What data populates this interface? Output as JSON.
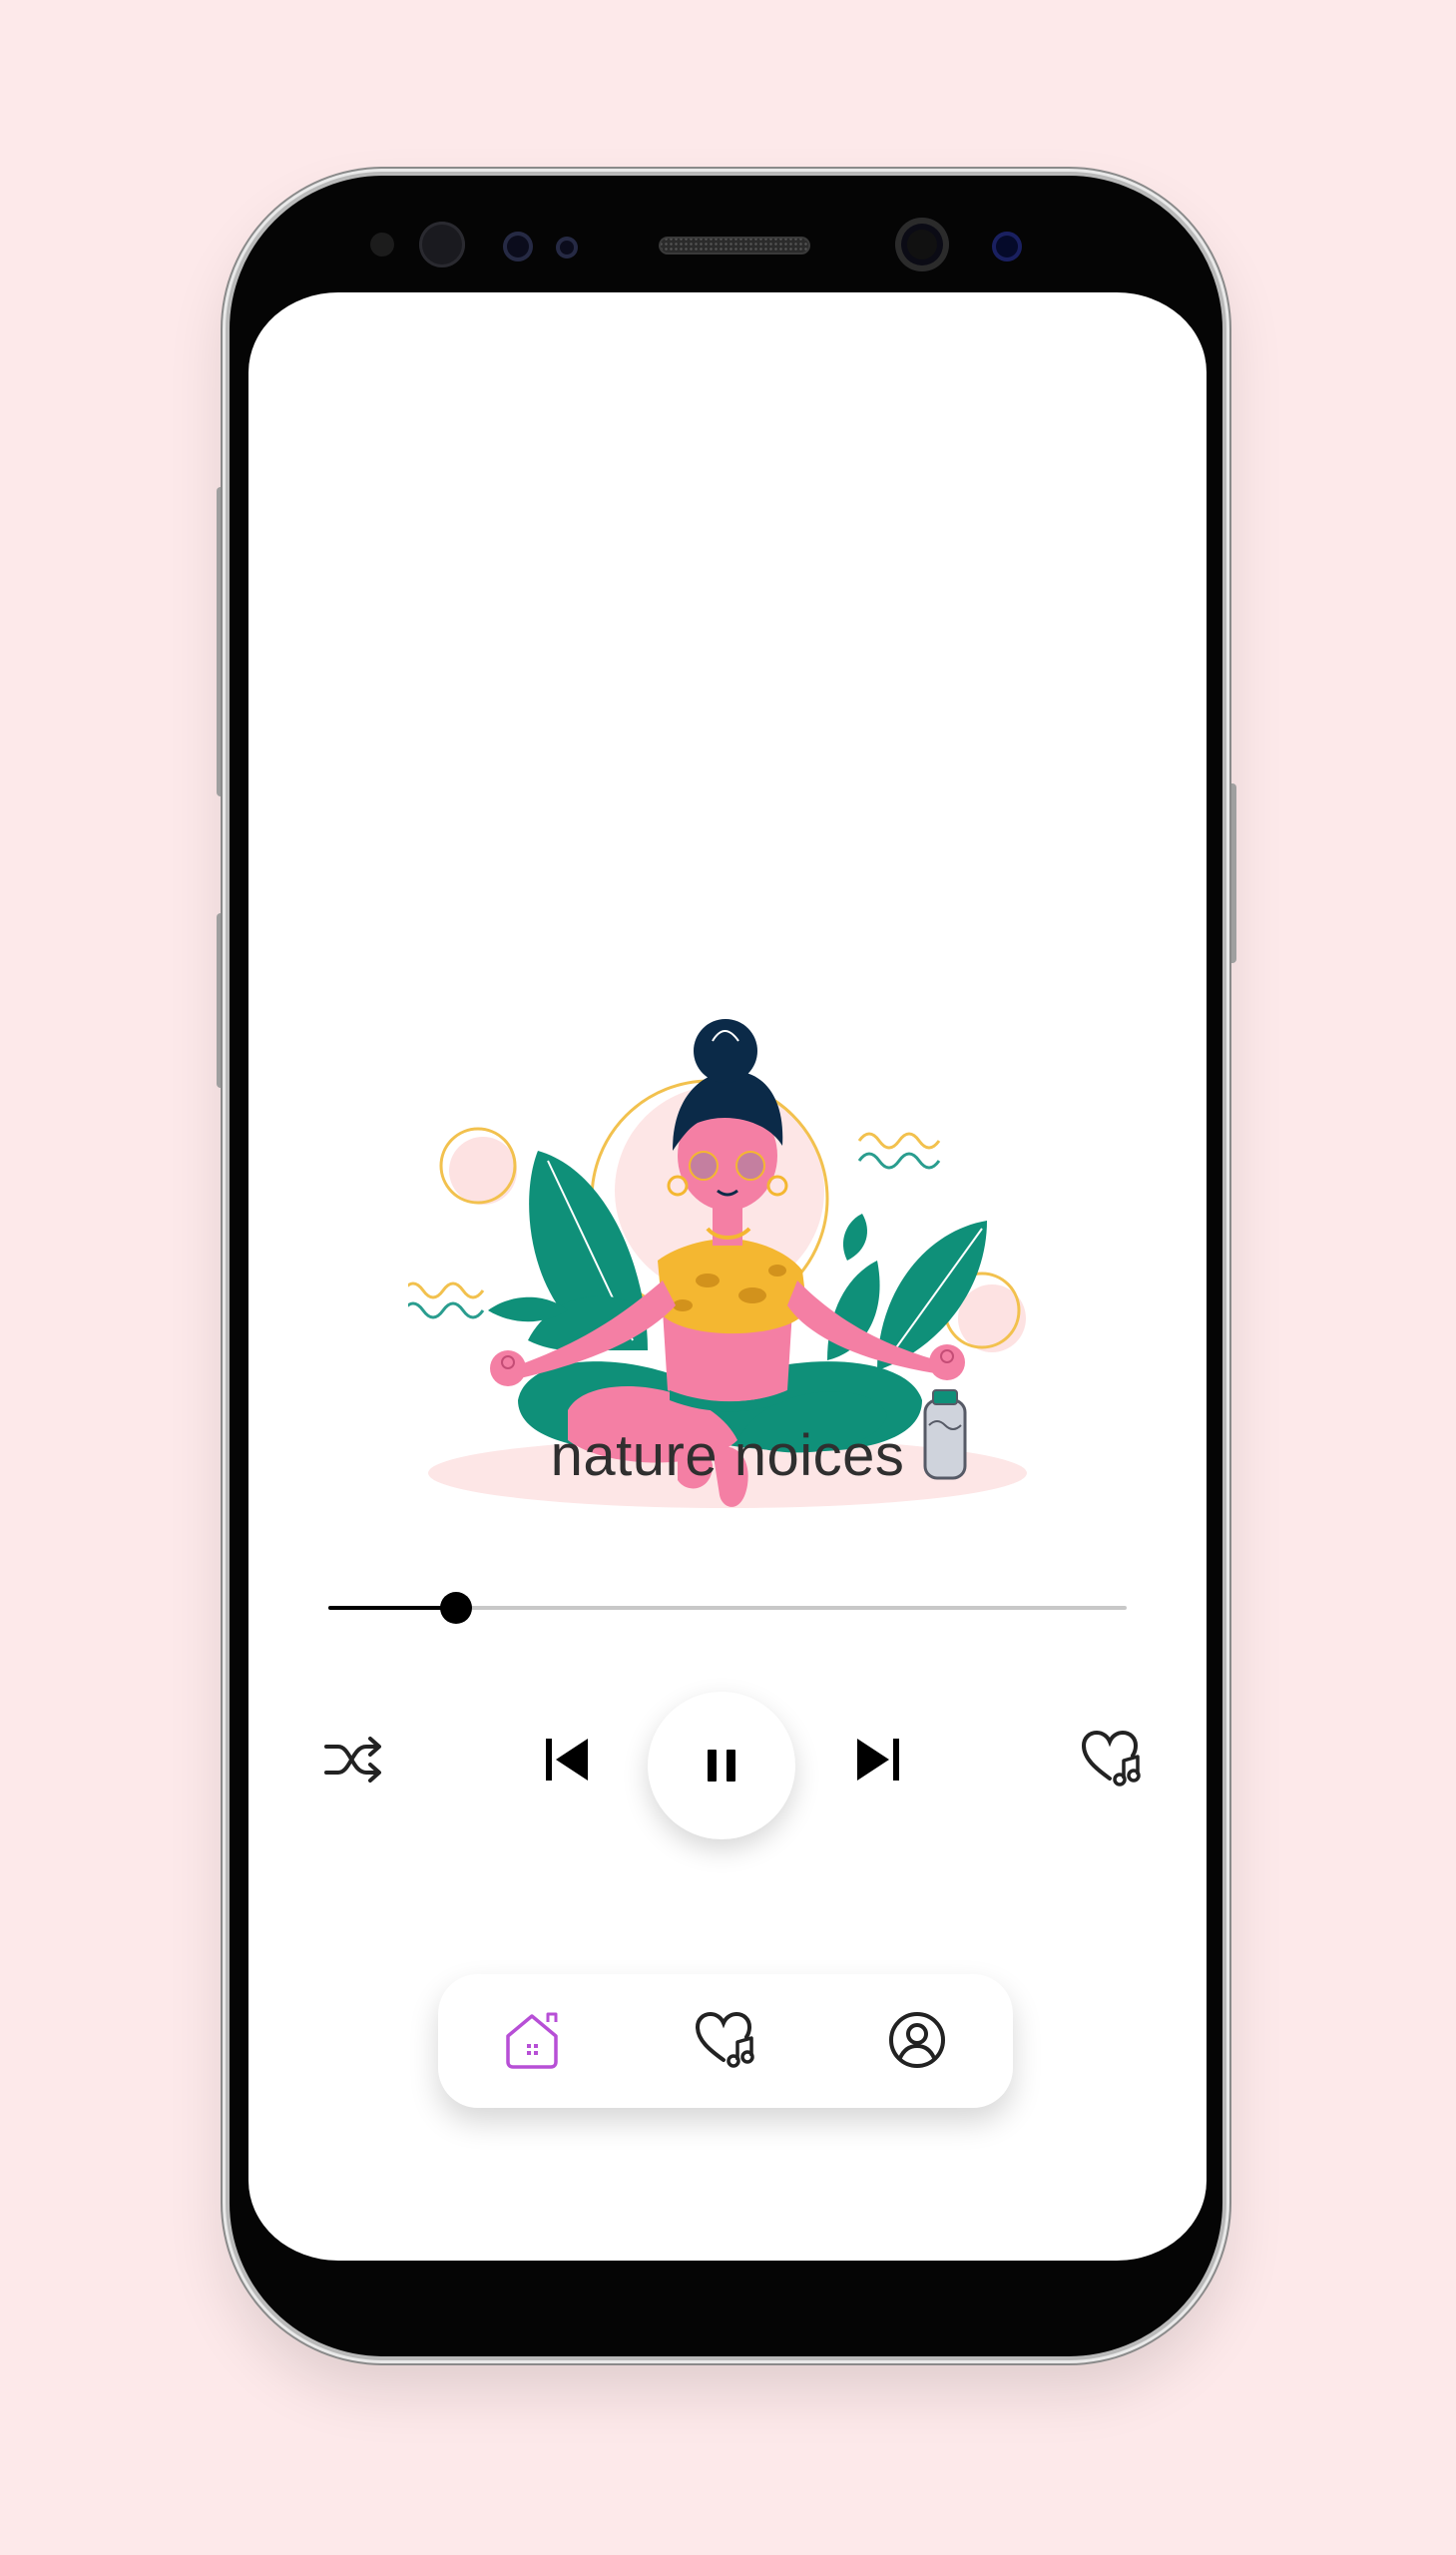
{
  "player": {
    "title": "nature noices",
    "progress": 0.16
  },
  "controls": {
    "shuffle_icon": "shuffle-icon",
    "previous_icon": "skip-previous-icon",
    "play_state_icon": "pause-icon",
    "next_icon": "skip-next-icon",
    "favorite_icon": "heart-music-icon"
  },
  "bottom_nav": {
    "items": [
      {
        "icon": "home-icon",
        "active": true
      },
      {
        "icon": "heart-music-icon",
        "active": false
      },
      {
        "icon": "user-circle-icon",
        "active": false
      }
    ],
    "active_color": "#b74fd6"
  },
  "colors": {
    "background": "#fde9ea",
    "screen": "#ffffff",
    "text": "#2f2f2f"
  }
}
